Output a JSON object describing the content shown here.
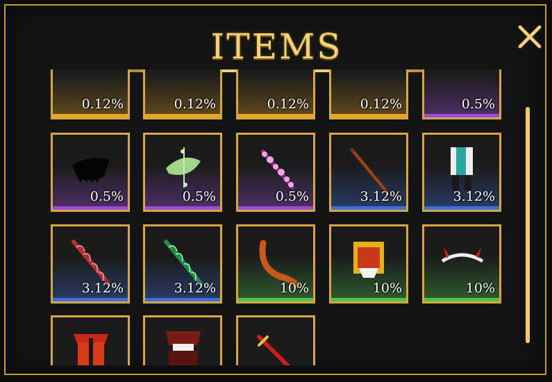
{
  "window": {
    "title": "ITEMS"
  },
  "colors": {
    "gold": "#d9a742",
    "mythic": "#9b4dd6",
    "legendary": "#e8a422",
    "rare": "#3d6fd8",
    "common": "#4fc24a"
  },
  "items": [
    {
      "pct": "0.12%",
      "rarity": "legendary",
      "icon": "dark-armor-icon"
    },
    {
      "pct": "0.12%",
      "rarity": "legendary",
      "icon": "dark-robe-icon"
    },
    {
      "pct": "0.12%",
      "rarity": "legendary",
      "icon": "dark-katana-icon"
    },
    {
      "pct": "0.12%",
      "rarity": "legendary",
      "icon": "dark-blade-icon"
    },
    {
      "pct": "0.5%",
      "rarity": "mythic",
      "icon": "purple-outfit-icon"
    },
    {
      "pct": "0.5%",
      "rarity": "mythic",
      "icon": "black-cape-icon"
    },
    {
      "pct": "0.5%",
      "rarity": "mythic",
      "icon": "green-leaf-icon"
    },
    {
      "pct": "0.5%",
      "rarity": "mythic",
      "icon": "pink-crystal-staff-icon"
    },
    {
      "pct": "3.12%",
      "rarity": "rare",
      "icon": "bronze-sword-icon"
    },
    {
      "pct": "3.12%",
      "rarity": "rare",
      "icon": "white-uniform-icon"
    },
    {
      "pct": "3.12%",
      "rarity": "rare",
      "icon": "red-energy-blade-icon"
    },
    {
      "pct": "3.12%",
      "rarity": "rare",
      "icon": "green-energy-blade-icon"
    },
    {
      "pct": "10%",
      "rarity": "common",
      "icon": "orange-tail-icon"
    },
    {
      "pct": "10%",
      "rarity": "common",
      "icon": "yellow-red-armor-icon"
    },
    {
      "pct": "10%",
      "rarity": "common",
      "icon": "horned-headband-icon"
    },
    {
      "pct": "",
      "rarity": "none",
      "icon": "red-vest-icon"
    },
    {
      "pct": "",
      "rarity": "none",
      "icon": "red-kimono-icon"
    },
    {
      "pct": "",
      "rarity": "none",
      "icon": "red-sword-icon"
    }
  ]
}
